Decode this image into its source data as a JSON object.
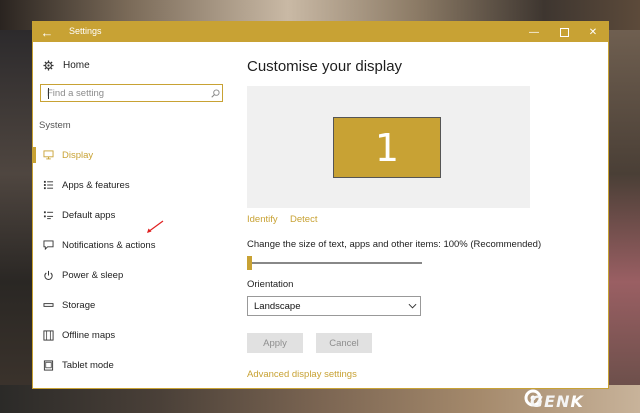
{
  "window": {
    "title": "Settings",
    "back_glyph": "←",
    "min_glyph": "—",
    "close_glyph": "✕"
  },
  "sidebar": {
    "home_label": "Home",
    "search_placeholder": "Find a setting",
    "section_label": "System",
    "items": [
      {
        "label": "Display",
        "icon": "monitor-icon",
        "active": true
      },
      {
        "label": "Apps & features",
        "icon": "apps-list-icon",
        "active": false
      },
      {
        "label": "Default apps",
        "icon": "default-apps-icon",
        "active": false
      },
      {
        "label": "Notifications & actions",
        "icon": "notification-icon",
        "active": false
      },
      {
        "label": "Power & sleep",
        "icon": "power-icon",
        "active": false
      },
      {
        "label": "Storage",
        "icon": "storage-icon",
        "active": false
      },
      {
        "label": "Offline maps",
        "icon": "map-icon",
        "active": false
      },
      {
        "label": "Tablet mode",
        "icon": "tablet-icon",
        "active": false
      }
    ]
  },
  "main": {
    "heading": "Customise your display",
    "monitor_number": "1",
    "identify_link": "Identify",
    "detect_link": "Detect",
    "scale_label": "Change the size of text, apps and other items: 100% (Recommended)",
    "scale_value": 100,
    "orientation_label": "Orientation",
    "orientation_value": "Landscape",
    "apply_label": "Apply",
    "cancel_label": "Cancel",
    "advanced_link": "Advanced display settings"
  },
  "watermark": {
    "text": "GEN",
    "k": "K"
  },
  "colors": {
    "accent": "#c8a234",
    "annotation": "#e02020"
  }
}
